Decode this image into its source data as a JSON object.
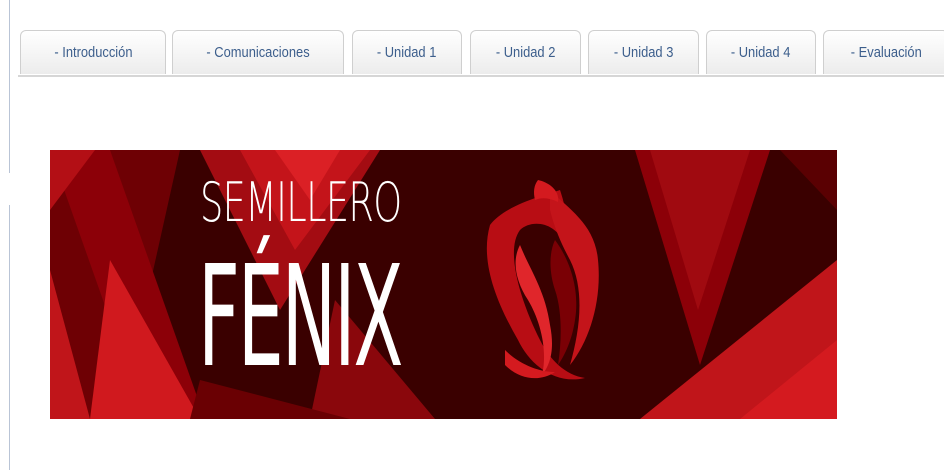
{
  "tabs": [
    {
      "label": "- Introducción"
    },
    {
      "label": "- Comunicaciones"
    },
    {
      "label": "- Unidad 1"
    },
    {
      "label": "- Unidad 2"
    },
    {
      "label": "- Unidad 3"
    },
    {
      "label": "- Unidad 4"
    },
    {
      "label": "- Evaluación"
    }
  ],
  "banner": {
    "line1": "SEMILLERO",
    "line2": "FÉNIX",
    "logo_icon": "phoenix-emblem",
    "colors": {
      "background": "#3a0000",
      "dark_red": "#7a0005",
      "red": "#b80d14",
      "bright_red": "#d41a1f",
      "text": "#ffffff"
    }
  }
}
